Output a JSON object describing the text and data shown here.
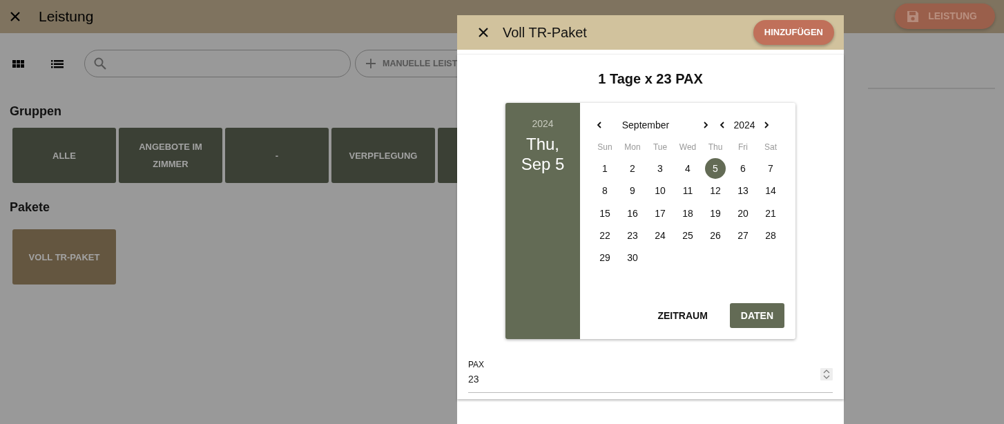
{
  "header": {
    "title": "Leistung",
    "save_button": "LEISTUNG"
  },
  "toolbar": {
    "view_modes": [
      {
        "kind": "grid",
        "selected": false
      },
      {
        "kind": "list",
        "selected": false
      }
    ],
    "manual_button": "MANUELLE LEIST"
  },
  "groups": {
    "title": "Gruppen",
    "items": [
      "ALLE",
      "ANGEBOTE IM ZIMMER",
      "-",
      "VERPFLEGUNG"
    ]
  },
  "packages": {
    "title": "Pakete",
    "items": [
      "VOLL TR-PAKET"
    ]
  },
  "dialog": {
    "title": "Voll TR-Paket",
    "add_button": "HINZUFÜGEN",
    "summary": "1 Tage x 23 PAX",
    "picker": {
      "year": "2024",
      "date": "Thu, Sep 5",
      "month": "September",
      "nav_year": "2024",
      "weekdays": [
        "Sun",
        "Mon",
        "Tue",
        "Wed",
        "Thu",
        "Fri",
        "Sat"
      ],
      "days": [
        {
          "label": "1",
          "selected": false
        },
        {
          "label": "2",
          "selected": false
        },
        {
          "label": "3",
          "selected": false
        },
        {
          "label": "4",
          "selected": false
        },
        {
          "label": "5",
          "selected": true
        },
        {
          "label": "6",
          "selected": false
        },
        {
          "label": "7",
          "selected": false
        },
        {
          "label": "8",
          "selected": false
        },
        {
          "label": "9",
          "selected": false
        },
        {
          "label": "10",
          "selected": false
        },
        {
          "label": "11",
          "selected": false
        },
        {
          "label": "12",
          "selected": false
        },
        {
          "label": "13",
          "selected": false
        },
        {
          "label": "14",
          "selected": false
        },
        {
          "label": "15",
          "selected": false
        },
        {
          "label": "16",
          "selected": false
        },
        {
          "label": "17",
          "selected": false
        },
        {
          "label": "18",
          "selected": false
        },
        {
          "label": "19",
          "selected": false
        },
        {
          "label": "20",
          "selected": false
        },
        {
          "label": "21",
          "selected": false
        },
        {
          "label": "22",
          "selected": false
        },
        {
          "label": "23",
          "selected": false
        },
        {
          "label": "24",
          "selected": false
        },
        {
          "label": "25",
          "selected": false
        },
        {
          "label": "26",
          "selected": false
        },
        {
          "label": "27",
          "selected": false
        },
        {
          "label": "28",
          "selected": false
        },
        {
          "label": "29",
          "selected": false
        },
        {
          "label": "30",
          "selected": false
        }
      ],
      "mode_buttons": [
        {
          "label": "ZEITRAUM",
          "selected": false
        },
        {
          "label": "DATEN",
          "selected": true
        }
      ]
    },
    "pax_field": {
      "label": "PAX",
      "value": "23"
    }
  }
}
